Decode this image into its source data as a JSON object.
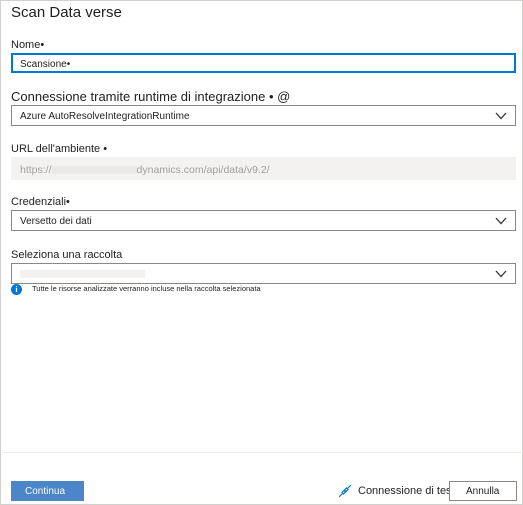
{
  "panel": {
    "title": "Scan Data verse"
  },
  "form": {
    "name": {
      "label": "Nome",
      "required_mark": "•",
      "value": "Scansione•"
    },
    "connection": {
      "label": "Connessione tramite runtime di integrazione",
      "required_mark": "•",
      "info_mark": "@",
      "value": "Azure AutoResolveIntegrationRuntime"
    },
    "environment_url": {
      "label": "URL dell'ambiente",
      "required_mark": "•",
      "value_prefix": "https://",
      "value_suffix": "dynamics.com/api/data/v9.2/"
    },
    "credentials": {
      "label": "Credenziali",
      "required_mark": "•",
      "value": "Versetto dei dati"
    },
    "collection": {
      "label": "Seleziona una raccolta",
      "value": "",
      "info_text": "Tutte le risorse analizzate verranno incluse nella raccolta selezionata"
    }
  },
  "footer": {
    "continue_label": "Continua",
    "test_connection_label": "Connessione di test",
    "cancel_label": "Annulla"
  },
  "colors": {
    "accent": "#0078d4",
    "primary_button": "#4a86c8",
    "border": "#8a8886",
    "readonly_bg": "#f3f2f1"
  },
  "icons": {
    "dropdown": "chevron-down-icon",
    "info": "info-icon",
    "test_connection": "plug-icon"
  }
}
